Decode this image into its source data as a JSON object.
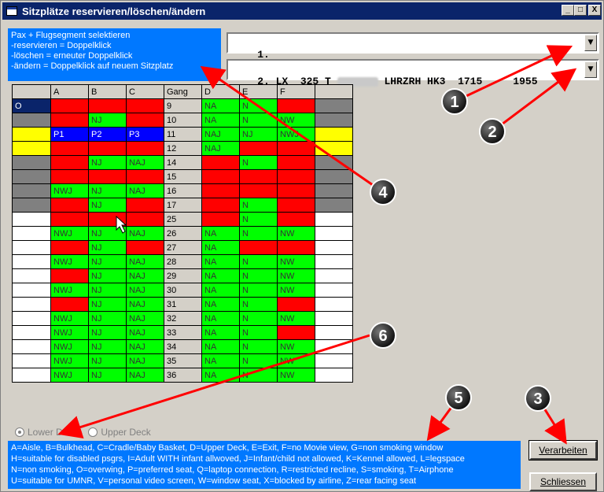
{
  "window": {
    "title": "Sitzplätze reservieren/löschen/ändern",
    "min": "_",
    "max": "□",
    "close": "X"
  },
  "info": {
    "lines": [
      "Pax + Flugsegment selektieren",
      "-reservieren = Doppelklick",
      "-löschen = erneuter Doppelklick",
      "-ändern = Doppelklick auf neuem Sitzplatz"
    ]
  },
  "pax_select": {
    "prefix": "1."
  },
  "segment_select": {
    "prefix": "2. LX  325 T ",
    "route": "LHRZRH HK3  1715",
    "time_end": "1955"
  },
  "seat_grid": {
    "headers": [
      "",
      "A",
      "B",
      "C",
      "Gang",
      "D",
      "E",
      "F",
      ""
    ],
    "rows": [
      {
        "cells": [
          [
            "O",
            "navy"
          ],
          [
            "",
            "red"
          ],
          [
            "",
            "red"
          ],
          [
            "",
            "red"
          ],
          [
            "9",
            "gang"
          ],
          [
            "NA",
            "green"
          ],
          [
            "N",
            "green"
          ],
          [
            "",
            "red"
          ],
          [
            "",
            "gray"
          ]
        ]
      },
      {
        "cells": [
          [
            "",
            "gray"
          ],
          [
            "",
            "red"
          ],
          [
            "NJ",
            "green"
          ],
          [
            "",
            "red"
          ],
          [
            "10",
            "gang"
          ],
          [
            "NA",
            "green"
          ],
          [
            "N",
            "green"
          ],
          [
            "NW",
            "green"
          ],
          [
            "",
            "gray"
          ]
        ]
      },
      {
        "cells": [
          [
            "",
            "yellow"
          ],
          [
            "P1",
            "blue"
          ],
          [
            "P2",
            "blue"
          ],
          [
            "P3",
            "blue"
          ],
          [
            "11",
            "gang"
          ],
          [
            "NAJ",
            "green"
          ],
          [
            "NJ",
            "green"
          ],
          [
            "NWJ",
            "green"
          ],
          [
            "",
            "yellow"
          ]
        ]
      },
      {
        "cells": [
          [
            "",
            "yellow"
          ],
          [
            "",
            "red"
          ],
          [
            "",
            "red"
          ],
          [
            "",
            "red"
          ],
          [
            "12",
            "gang"
          ],
          [
            "NAJ",
            "green"
          ],
          [
            "",
            "red"
          ],
          [
            "",
            "red"
          ],
          [
            "",
            "yellow"
          ]
        ]
      },
      {
        "cells": [
          [
            "",
            "gray"
          ],
          [
            "",
            "red"
          ],
          [
            "NJ",
            "green"
          ],
          [
            "NAJ",
            "green"
          ],
          [
            "14",
            "gang"
          ],
          [
            "",
            "red"
          ],
          [
            "N",
            "green"
          ],
          [
            "",
            "red"
          ],
          [
            "",
            "gray"
          ]
        ]
      },
      {
        "cells": [
          [
            "",
            "gray"
          ],
          [
            "",
            "red"
          ],
          [
            "",
            "red"
          ],
          [
            "",
            "red"
          ],
          [
            "15",
            "gang"
          ],
          [
            "",
            "red"
          ],
          [
            "",
            "red"
          ],
          [
            "",
            "red"
          ],
          [
            "",
            "gray"
          ]
        ]
      },
      {
        "cells": [
          [
            "",
            "gray"
          ],
          [
            "NWJ",
            "green"
          ],
          [
            "NJ",
            "green"
          ],
          [
            "NAJ",
            "green"
          ],
          [
            "16",
            "gang"
          ],
          [
            "",
            "red"
          ],
          [
            "",
            "red"
          ],
          [
            "",
            "red"
          ],
          [
            "",
            "gray"
          ]
        ]
      },
      {
        "cells": [
          [
            "",
            "gray"
          ],
          [
            "",
            "red"
          ],
          [
            "NJ",
            "green"
          ],
          [
            "",
            "red"
          ],
          [
            "17",
            "gang"
          ],
          [
            "",
            "red"
          ],
          [
            "N",
            "green"
          ],
          [
            "",
            "red"
          ],
          [
            "",
            "gray"
          ]
        ]
      },
      {
        "cells": [
          [
            "",
            "white"
          ],
          [
            "",
            "red"
          ],
          [
            "",
            "red"
          ],
          [
            "",
            "red"
          ],
          [
            "25",
            "gang"
          ],
          [
            "",
            "red"
          ],
          [
            "N",
            "green"
          ],
          [
            "",
            "red"
          ],
          [
            "",
            "white"
          ]
        ]
      },
      {
        "cells": [
          [
            "",
            "white"
          ],
          [
            "NWJ",
            "green"
          ],
          [
            "NJ",
            "green"
          ],
          [
            "NAJ",
            "green"
          ],
          [
            "26",
            "gang"
          ],
          [
            "NA",
            "green"
          ],
          [
            "N",
            "green"
          ],
          [
            "NW",
            "green"
          ],
          [
            "",
            "white"
          ]
        ]
      },
      {
        "cells": [
          [
            "",
            "white"
          ],
          [
            "",
            "red"
          ],
          [
            "NJ",
            "green"
          ],
          [
            "",
            "red"
          ],
          [
            "27",
            "gang"
          ],
          [
            "NA",
            "green"
          ],
          [
            "",
            "red"
          ],
          [
            "",
            "red"
          ],
          [
            "",
            "white"
          ]
        ]
      },
      {
        "cells": [
          [
            "",
            "white"
          ],
          [
            "NWJ",
            "green"
          ],
          [
            "NJ",
            "green"
          ],
          [
            "NAJ",
            "green"
          ],
          [
            "28",
            "gang"
          ],
          [
            "NA",
            "green"
          ],
          [
            "N",
            "green"
          ],
          [
            "NW",
            "green"
          ],
          [
            "",
            "white"
          ]
        ]
      },
      {
        "cells": [
          [
            "",
            "white"
          ],
          [
            "",
            "red"
          ],
          [
            "NJ",
            "green"
          ],
          [
            "NAJ",
            "green"
          ],
          [
            "29",
            "gang"
          ],
          [
            "NA",
            "green"
          ],
          [
            "N",
            "green"
          ],
          [
            "NW",
            "green"
          ],
          [
            "",
            "white"
          ]
        ]
      },
      {
        "cells": [
          [
            "",
            "white"
          ],
          [
            "NWJ",
            "green"
          ],
          [
            "NJ",
            "green"
          ],
          [
            "NAJ",
            "green"
          ],
          [
            "30",
            "gang"
          ],
          [
            "NA",
            "green"
          ],
          [
            "N",
            "green"
          ],
          [
            "NW",
            "green"
          ],
          [
            "",
            "white"
          ]
        ]
      },
      {
        "cells": [
          [
            "",
            "white"
          ],
          [
            "",
            "red"
          ],
          [
            "NJ",
            "green"
          ],
          [
            "NAJ",
            "green"
          ],
          [
            "31",
            "gang"
          ],
          [
            "NA",
            "green"
          ],
          [
            "N",
            "green"
          ],
          [
            "",
            "red"
          ],
          [
            "",
            "white"
          ]
        ]
      },
      {
        "cells": [
          [
            "",
            "white"
          ],
          [
            "NWJ",
            "green"
          ],
          [
            "NJ",
            "green"
          ],
          [
            "NAJ",
            "green"
          ],
          [
            "32",
            "gang"
          ],
          [
            "NA",
            "green"
          ],
          [
            "N",
            "green"
          ],
          [
            "NW",
            "green"
          ],
          [
            "",
            "white"
          ]
        ]
      },
      {
        "cells": [
          [
            "",
            "white"
          ],
          [
            "NWJ",
            "green"
          ],
          [
            "NJ",
            "green"
          ],
          [
            "NAJ",
            "green"
          ],
          [
            "33",
            "gang"
          ],
          [
            "NA",
            "green"
          ],
          [
            "N",
            "green"
          ],
          [
            "",
            "red"
          ],
          [
            "",
            "white"
          ]
        ]
      },
      {
        "cells": [
          [
            "",
            "white"
          ],
          [
            "NWJ",
            "green"
          ],
          [
            "NJ",
            "green"
          ],
          [
            "NAJ",
            "green"
          ],
          [
            "34",
            "gang"
          ],
          [
            "NA",
            "green"
          ],
          [
            "N",
            "green"
          ],
          [
            "NW",
            "green"
          ],
          [
            "",
            "white"
          ]
        ]
      },
      {
        "cells": [
          [
            "",
            "white"
          ],
          [
            "NWJ",
            "green"
          ],
          [
            "NJ",
            "green"
          ],
          [
            "NAJ",
            "green"
          ],
          [
            "35",
            "gang"
          ],
          [
            "NA",
            "green"
          ],
          [
            "N",
            "green"
          ],
          [
            "NW",
            "green"
          ],
          [
            "",
            "white"
          ]
        ]
      },
      {
        "cells": [
          [
            "",
            "white"
          ],
          [
            "NWJ",
            "green"
          ],
          [
            "NJ",
            "green"
          ],
          [
            "NAJ",
            "green"
          ],
          [
            "36",
            "gang"
          ],
          [
            "NA",
            "green"
          ],
          [
            "N",
            "green"
          ],
          [
            "NW",
            "green"
          ],
          [
            "",
            "white"
          ]
        ]
      }
    ]
  },
  "deck": {
    "lower": "Lower Deck",
    "upper": "Upper Deck",
    "selected": "lower"
  },
  "legend": {
    "lines": [
      "A=Aisle, B=Bulkhead, C=Cradle/Baby Basket, D=Upper Deck, E=Exit, F=no Movie view, G=non smoking window",
      "H=suitable for disabled psgrs, I=Adult WITH infant allwoved, J=Infant/child not allowed, K=Kennel allowed, L=legspace",
      "N=non smoking, O=overwing, P=preferred seat, Q=laptop connection, R=restricted recline, S=smoking, T=Airphone",
      "U=suitable for UMNR, V=personal video screen, W=window seat, X=blocked by airline, Z=rear facing seat"
    ]
  },
  "buttons": {
    "process": "Verarbeiten",
    "close": "Schliessen"
  },
  "callouts": [
    "1",
    "2",
    "3",
    "4",
    "5",
    "6"
  ],
  "colors": {
    "occupied": "#ff0000",
    "free": "#00ff00",
    "selected": "#0000ff",
    "exit_row": "#ffff00",
    "info_panel": "#0078ff",
    "callout_arrow": "#ff0000"
  }
}
